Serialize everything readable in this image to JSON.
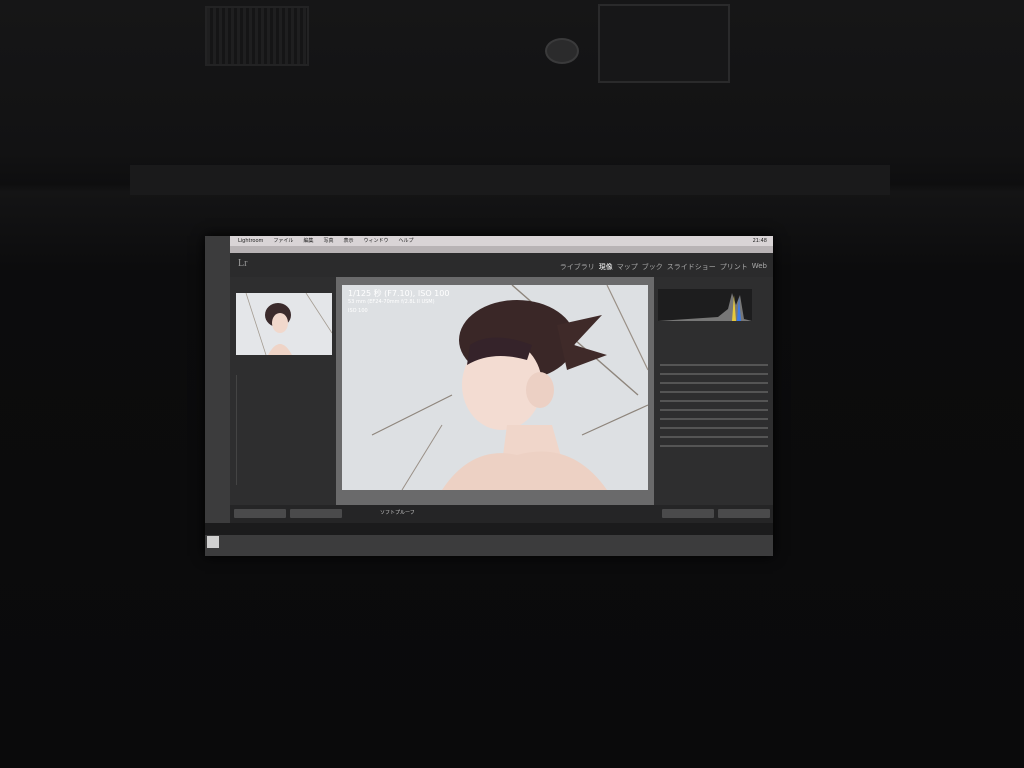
{
  "menubar": {
    "app": "Lightroom",
    "items": [
      "ファイル",
      "編集",
      "写真",
      "表示",
      "ウィンドウ",
      "ヘルプ"
    ],
    "clock": "21:48"
  },
  "lr": {
    "logo": "Lr",
    "modules": [
      {
        "label": "ライブラリ",
        "active": false
      },
      {
        "label": "現像",
        "active": true
      },
      {
        "label": "マップ",
        "active": false
      },
      {
        "label": "ブック",
        "active": false
      },
      {
        "label": "スライドショー",
        "active": false
      },
      {
        "label": "プリント",
        "active": false
      },
      {
        "label": "Web",
        "active": false
      }
    ]
  },
  "photo_info": {
    "exposure": "1/125 秒 (F7.10), ISO 100",
    "lens": "53 mm (EF24-70mm f/2.8L II USM)",
    "iso": "ISO 100"
  },
  "toolbar": {
    "softproof": "ソフトプルーフ"
  }
}
